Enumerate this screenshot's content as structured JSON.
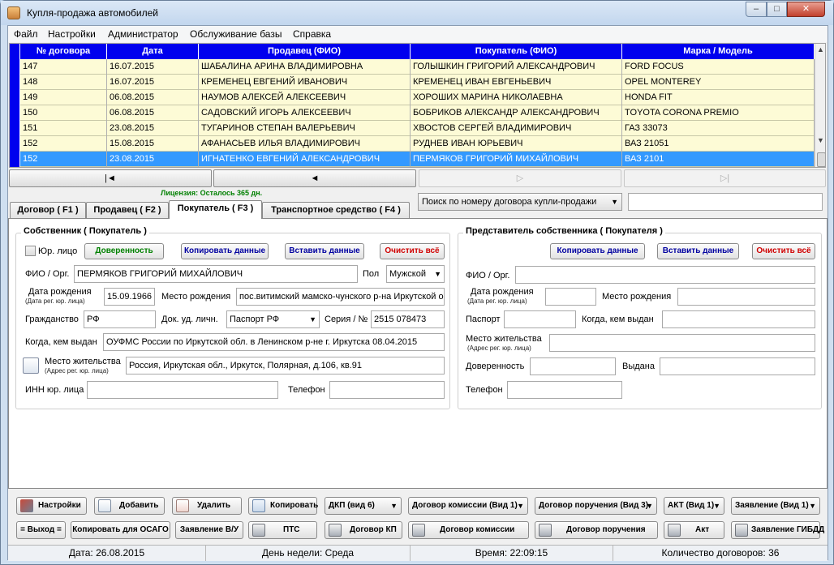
{
  "window": {
    "title": "Купля-продажа автомобилей",
    "min": "‒",
    "max": "□",
    "close": "✕"
  },
  "menu": [
    "Файл",
    "Настройки",
    "Администратор",
    "Обслуживание базы",
    "Справка"
  ],
  "grid": {
    "columns": [
      "№ договора",
      "Дата",
      "Продавец (ФИО)",
      "Покупатель (ФИО)",
      "Марка / Модель"
    ],
    "rows": [
      {
        "num": "147",
        "date": "16.07.2015",
        "seller": "ШАБАЛИНА АРИНА ВЛАДИМИРОВНА",
        "buyer": "ГОЛЫШКИН ГРИГОРИЙ АЛЕКСАНДРОВИЧ",
        "model": "FORD FOCUS"
      },
      {
        "num": "148",
        "date": "16.07.2015",
        "seller": "КРЕМЕНЕЦ ЕВГЕНИЙ ИВАНОВИЧ",
        "buyer": "КРЕМЕНЕЦ ИВАН ЕВГЕНЬЕВИЧ",
        "model": "OPEL MONTEREY"
      },
      {
        "num": "149",
        "date": "06.08.2015",
        "seller": "НАУМОВ АЛЕКСЕЙ АЛЕКСЕЕВИЧ",
        "buyer": "ХОРОШИХ МАРИНА НИКОЛАЕВНА",
        "model": "HONDA FIT"
      },
      {
        "num": "150",
        "date": "06.08.2015",
        "seller": "САДОВСКИЙ ИГОРЬ АЛЕКСЕЕВИЧ",
        "buyer": "БОБРИКОВ АЛЕКСАНДР АЛЕКСАНДРОВИЧ",
        "model": "TOYOTA CORONA PREMIO"
      },
      {
        "num": "151",
        "date": "23.08.2015",
        "seller": "ТУГАРИНОВ СТЕПАН ВАЛЕРЬЕВИЧ",
        "buyer": "ХВОСТОВ СЕРГЕЙ ВЛАДИМИРОВИЧ",
        "model": "ГАЗ 33073"
      },
      {
        "num": "152",
        "date": "15.08.2015",
        "seller": "АФАНАСЬЕВ ИЛЬЯ ВЛАДИМИРОВИЧ",
        "buyer": "РУДНЕВ ИВАН ЮРЬЕВИЧ",
        "model": "ВАЗ 21051"
      },
      {
        "num": "152",
        "date": "23.08.2015",
        "seller": "ИГНАТЕНКО ЕВГЕНИЙ АЛЕКСАНДРОВИЧ",
        "buyer": "ПЕРМЯКОВ ГРИГОРИЙ МИХАЙЛОВИЧ",
        "model": "ВАЗ 2101",
        "selected": true
      }
    ]
  },
  "nav": {
    "first": "|◄",
    "prev": "◄",
    "next": "▷",
    "last": "▷|"
  },
  "license": "Лицензия: Осталось 365 дн.",
  "tabs": [
    "Договор ( F1 )",
    "Продавец ( F2 )",
    "Покупатель ( F3 )",
    "Транспортное средство ( F4 )"
  ],
  "search": {
    "mode": "Поиск по номеру договора купли-продажи",
    "value": ""
  },
  "owner": {
    "title": "Собственник ( Покупатель )",
    "legal_entity_label": "Юр. лицо",
    "btn_power_of_attorney": "Доверенность",
    "btn_copy": "Копировать данные",
    "btn_paste": "Вставить данные",
    "btn_clear": "Очистить всё",
    "fio_label": "ФИО / Орг.",
    "fio": "ПЕРМЯКОВ ГРИГОРИЙ МИХАЙЛОВИЧ",
    "sex_label": "Пол",
    "sex": "Мужской",
    "dob_label": "Дата рождения",
    "dob_sub": "(Дата рег. юр. лица)",
    "dob": "15.09.1966",
    "pob_label": "Место рождения",
    "pob": "пос.витимский мамско-чунского р-на Иркутской о",
    "citizenship_label": "Гражданство",
    "citizenship": "РФ",
    "doc_label": "Док. уд. личн.",
    "doc": "Паспорт РФ",
    "series_label": "Серия / №",
    "series": "2515 078473",
    "issued_label": "Когда, кем выдан",
    "issued": "ОУФМС России по Иркутской обл. в Ленинском р-не г. Иркутска 08.04.2015",
    "residence_label": "Место жительства",
    "residence_sub": "(Адрес рег. юр. лица)",
    "residence": "Россия, Иркутская обл., Иркутск, Полярная, д.106, кв.91",
    "inn_label": "ИНН юр. лица",
    "inn": "",
    "phone_label": "Телефон",
    "phone": ""
  },
  "rep": {
    "title": "Представитель собственника ( Покупателя )",
    "btn_copy": "Копировать данные",
    "btn_paste": "Вставить данные",
    "btn_clear": "Очистить всё",
    "fio_label": "ФИО / Орг.",
    "dob_label": "Дата рождения",
    "dob_sub": "(Дата рег. юр. лица)",
    "pob_label": "Место рождения",
    "passport_label": "Паспорт",
    "issued_label": "Когда, кем выдан",
    "residence_label": "Место жительства",
    "residence_sub": "(Адрес рег. юр. лица)",
    "poa_label": "Доверенность",
    "poa_issued_label": "Выдана",
    "phone_label": "Телефон"
  },
  "toolbar": {
    "settings": "Настройки",
    "add": "Добавить",
    "delete": "Удалить",
    "copy": "Копировать",
    "dkp": "ДКП (вид 6)",
    "commission": "Договор комиссии (Вид 1)",
    "assignment": "Договор поручения (Вид 3)",
    "act": "АКТ (Вид 1)",
    "statement": "Заявление (Вид 1)",
    "exit": "= Выход =",
    "copy_osago": "Копировать для ОСАГО",
    "statement_vu": "Заявление В/У",
    "pts": "ПТС",
    "contract_kp": "Договор КП",
    "print_commission": "Договор комиссии",
    "print_assignment": "Договор поручения",
    "print_act": "Акт",
    "statement_gibdd": "Заявление ГИБДД"
  },
  "status": {
    "date": "Дата: 26.08.2015",
    "weekday": "День недели: Среда",
    "time": "Время: 22:09:15",
    "count": "Количество договоров: 36"
  },
  "colors": {
    "grid_header": "#0000ee",
    "row_bg": "#fdfbd6",
    "row_selected": "#3399ff",
    "license": "#008000"
  }
}
